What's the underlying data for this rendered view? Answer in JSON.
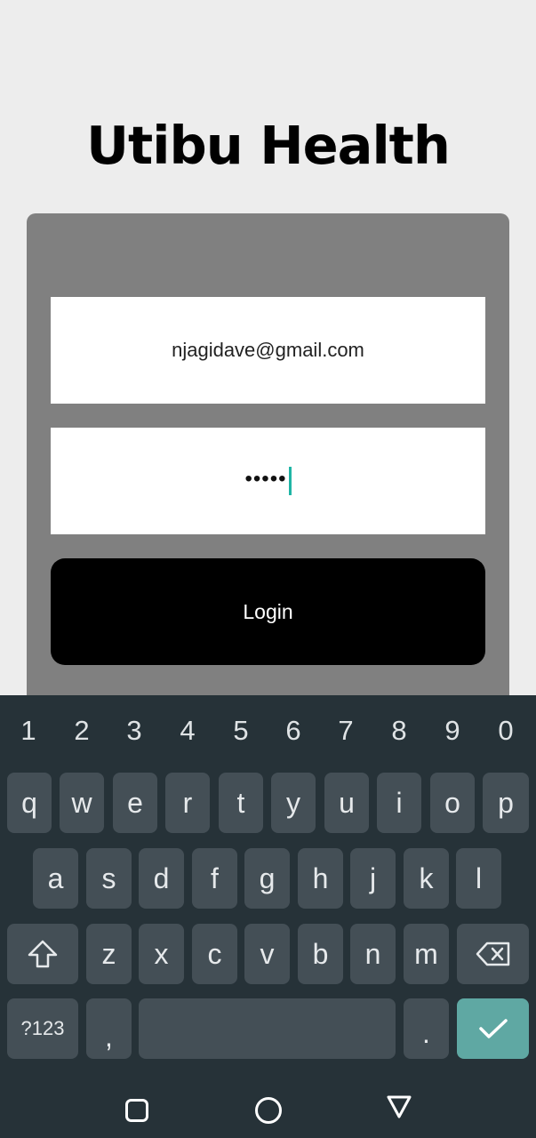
{
  "app": {
    "title": "Utibu Health"
  },
  "form": {
    "email_value": "njagidave@gmail.com",
    "password_masked": "•••••",
    "login_label": "Login"
  },
  "keyboard": {
    "numbers": [
      "1",
      "2",
      "3",
      "4",
      "5",
      "6",
      "7",
      "8",
      "9",
      "0"
    ],
    "row1": [
      "q",
      "w",
      "e",
      "r",
      "t",
      "y",
      "u",
      "i",
      "o",
      "p"
    ],
    "row2": [
      "a",
      "s",
      "d",
      "f",
      "g",
      "h",
      "j",
      "k",
      "l"
    ],
    "row3": [
      "z",
      "x",
      "c",
      "v",
      "b",
      "n",
      "m"
    ],
    "symbols_label": "?123",
    "comma": ",",
    "period": ".",
    "shift_icon": "shift-arrow-icon",
    "backspace_icon": "backspace-icon",
    "enter_icon": "checkmark-icon"
  },
  "navbar": {
    "recents_icon": "square-icon",
    "home_icon": "circle-icon",
    "back_icon": "triangle-down-icon"
  },
  "colors": {
    "page_bg": "#ededed",
    "card_bg": "#808080",
    "button_bg": "#000000",
    "keyboard_bg": "#263238",
    "key_bg": "#444f56",
    "enter_bg": "#5fa8a3",
    "caret": "#1fb5a5"
  }
}
